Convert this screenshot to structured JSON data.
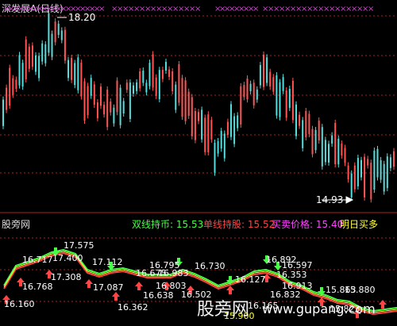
{
  "header": {
    "title": "深发展A(日线)"
  },
  "top_panel": {
    "max_label": "18.20",
    "min_label": "14.93",
    "colors": {
      "up": "#ff5555",
      "down": "#55dddd",
      "grid": "#aa2222",
      "markers": "#cc44cc"
    }
  },
  "bottom_panel": {
    "title": "股旁网",
    "legend": [
      {
        "label": "双线持币:",
        "value": "15.53",
        "color": "#44ff44"
      },
      {
        "label": "单线持股:",
        "value": "15.52",
        "color": "#ff4444"
      },
      {
        "label": "买卖价格:",
        "value": "15.40",
        "color": "#ff44ff"
      },
      {
        "label": "明日买多",
        "value": "",
        "color": "#ffff44"
      }
    ],
    "value_labels": [
      "17.575",
      "16.717",
      "17.400",
      "17.112",
      "16.768",
      "17.308",
      "17.087",
      "16.160",
      "16.795",
      "16.730",
      "16.675",
      "16.983",
      "16.803",
      "16.638",
      "16.362",
      "16.502",
      "16.127",
      "16.892",
      "16.597",
      "16.353",
      "16.913",
      "16.832",
      "15.863",
      "15.880",
      "15.823",
      "15.900",
      "16.165"
    ]
  },
  "watermark": {
    "text": "股旁网",
    "url": "www.gupang.com"
  }
}
